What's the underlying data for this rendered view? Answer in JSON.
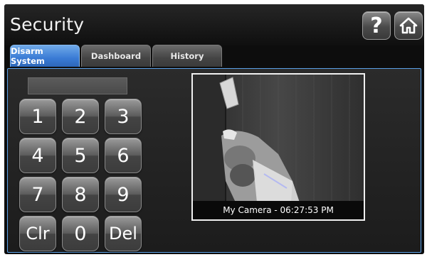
{
  "app": {
    "title": "Security"
  },
  "header": {
    "help_label": "?",
    "home_icon": "home-icon"
  },
  "tabs": [
    {
      "label": "Disarm System",
      "active": true
    },
    {
      "label": "Dashboard",
      "active": false
    },
    {
      "label": "History",
      "active": false
    }
  ],
  "keypad": {
    "code_value": "",
    "keys": [
      "1",
      "2",
      "3",
      "4",
      "5",
      "6",
      "7",
      "8",
      "9",
      "Clr",
      "0",
      "Del"
    ]
  },
  "camera": {
    "caption": "My Camera - 06:27:53 PM"
  },
  "colors": {
    "accent": "#3a7bd5",
    "panel_border": "#5aa0e6",
    "background": "#0d0d0d"
  }
}
